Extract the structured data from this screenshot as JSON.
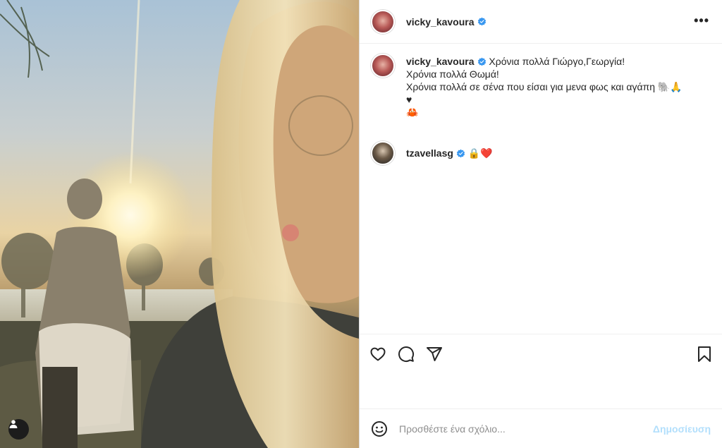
{
  "post": {
    "username": "vicky_kavoura",
    "verified": true,
    "more_icon": "more-horizontal-icon"
  },
  "comments": [
    {
      "username": "vicky_kavoura",
      "verified": true,
      "lines": [
        "Χρόνια πολλά Γιώργο,Γεωργία!",
        "Χρόνια πολλά Θωμά!",
        "Χρόνια πολλά σε σένα που είσαι για μενα φως και αγάπη 🐘🙏",
        "♥",
        "🦀"
      ]
    },
    {
      "username": "tzavellasg",
      "verified": true,
      "text": "🔒❤️"
    }
  ],
  "actions": {
    "like_icon": "heart-icon",
    "comment_icon": "comment-icon",
    "share_icon": "send-icon",
    "save_icon": "bookmark-icon"
  },
  "composer": {
    "placeholder": "Προσθέστε ένα σχόλιο...",
    "post_label": "Δημοσίευση",
    "emoji_icon": "emoji-icon"
  },
  "colors": {
    "verified": "#3897f0",
    "post_button_disabled": "#b2dffc",
    "text": "#262626",
    "border": "#dbdbdb"
  }
}
